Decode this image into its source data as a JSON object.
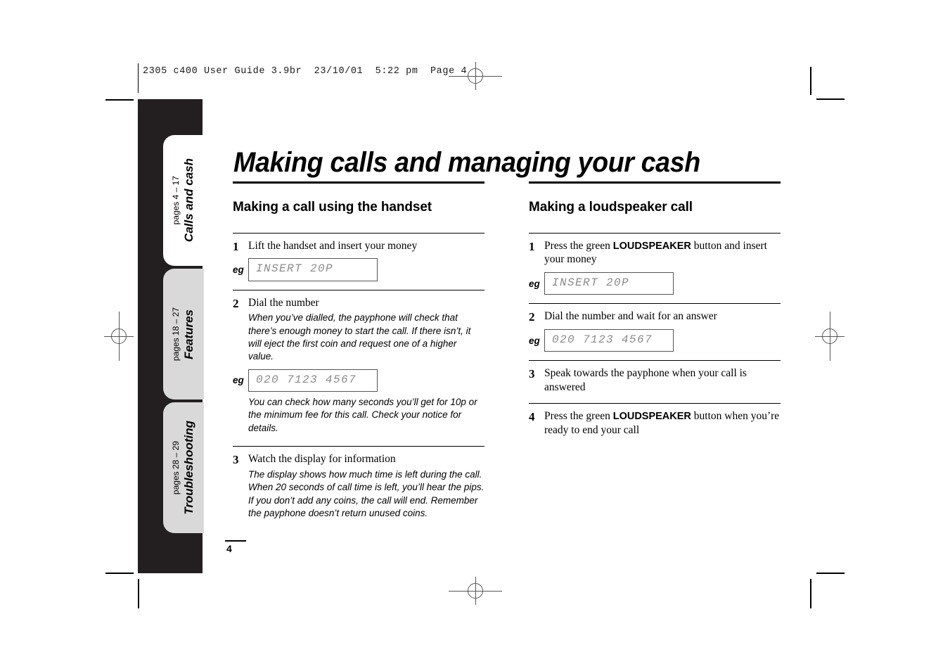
{
  "prepress": {
    "slug": "2305 c400 User Guide 3.9br  23/10/01  5:22 pm  Page 4"
  },
  "sidebar": {
    "tabs": [
      {
        "label": "Calls and cash",
        "pages": "pages 4 – 17",
        "state": "active"
      },
      {
        "label": "Features",
        "pages": "pages 18 – 27",
        "state": "inactive"
      },
      {
        "label": "Troubleshooting",
        "pages": "pages 28 – 29",
        "state": "inactive"
      }
    ]
  },
  "page": {
    "title": "Making calls and managing your cash",
    "folio": "4"
  },
  "sections": {
    "handset": {
      "heading": "Making a call using the handset",
      "steps": {
        "one": {
          "num": "1",
          "text": "Lift the handset and insert your money",
          "eg_label": "eg",
          "display": "INSERT 20P"
        },
        "two": {
          "num": "2",
          "text": "Dial the number",
          "note_before": "When you’ve dialled, the payphone will check that there’s enough money to start the call. If there isn’t, it will eject the first coin and request one of a higher value.",
          "eg_label": "eg",
          "display": "020 7123 4567",
          "note_after": "You can check how many seconds you’ll get for 10p or the minimum fee for this call. Check your notice for details."
        },
        "three": {
          "num": "3",
          "text": "Watch the display for information",
          "note": "The display shows how much time is left during the call. When 20 seconds of call time is left, you’ll hear the pips. If you don’t add any coins, the call will end. Remember the payphone doesn’t return unused coins."
        }
      }
    },
    "loudspeaker": {
      "heading": "Making a loudspeaker call",
      "steps": {
        "one": {
          "num": "1",
          "text_before": "Press the green ",
          "emphasis": "LOUDSPEAKER",
          "text_after": " button and insert your money",
          "eg_label": "eg",
          "display": "INSERT 20P"
        },
        "two": {
          "num": "2",
          "text": "Dial the number and wait for an answer",
          "eg_label": "eg",
          "display": "020 7123 4567"
        },
        "three": {
          "num": "3",
          "text": "Speak towards the payphone when your call is answered"
        },
        "four": {
          "num": "4",
          "text_before": "Press the green ",
          "emphasis": "LOUDSPEAKER",
          "text_after": " button when you’re ready to end your call"
        }
      }
    }
  },
  "colors": {
    "spine": "#231f20",
    "tab_active": "#ffffff",
    "tab_inactive": "#d9d9d9",
    "lcd_text": "#8a8a8a"
  }
}
